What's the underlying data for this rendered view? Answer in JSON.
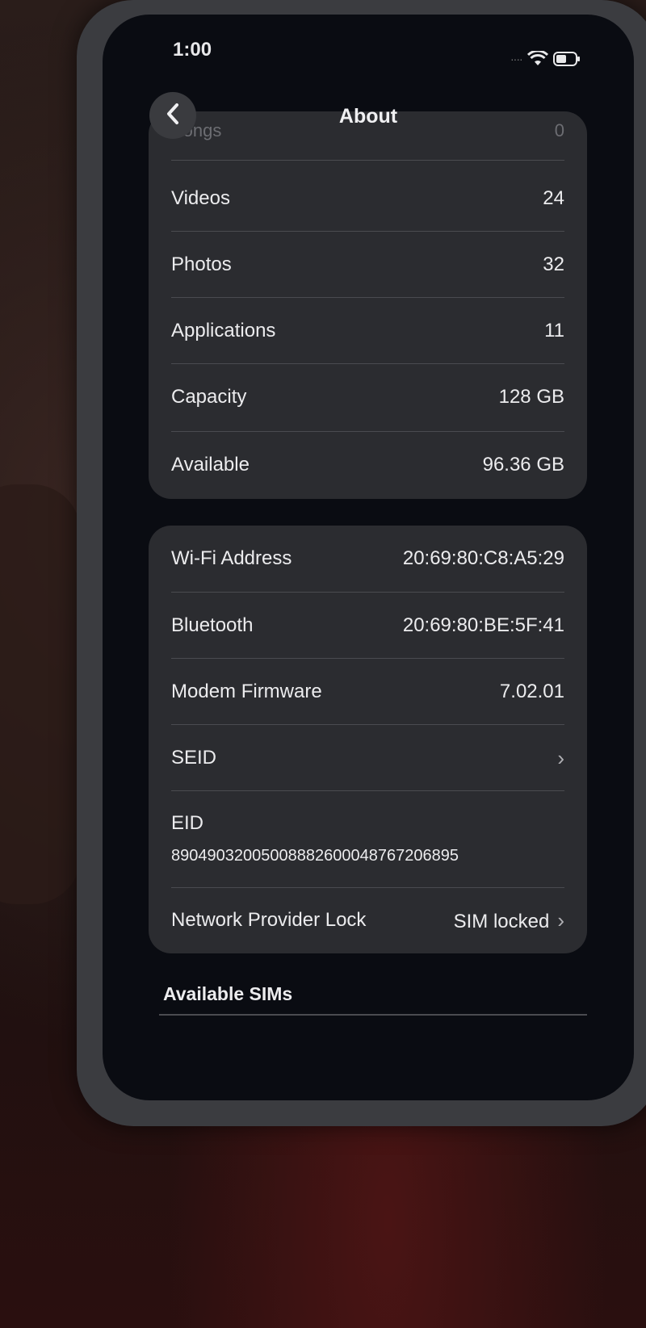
{
  "status": {
    "time": "1:00"
  },
  "nav": {
    "title": "About"
  },
  "storage": {
    "partial_label": "Songs",
    "partial_value": "0",
    "rows": [
      {
        "label": "Videos",
        "value": "24"
      },
      {
        "label": "Photos",
        "value": "32"
      },
      {
        "label": "Applications",
        "value": "11"
      },
      {
        "label": "Capacity",
        "value": "128 GB"
      },
      {
        "label": "Available",
        "value": "96.36 GB"
      }
    ]
  },
  "network": {
    "rows": [
      {
        "label": "Wi-Fi Address",
        "value": "20:69:80:C8:A5:29"
      },
      {
        "label": "Bluetooth",
        "value": "20:69:80:BE:5F:41"
      },
      {
        "label": "Modem Firmware",
        "value": "7.02.01"
      },
      {
        "label": "SEID"
      }
    ],
    "eid_label": "EID",
    "eid_value": "89049032005008882600048767206895",
    "lock_label": "Network Provider Lock",
    "lock_value": "SIM locked"
  },
  "sims": {
    "section_label": "Available SIMs"
  }
}
